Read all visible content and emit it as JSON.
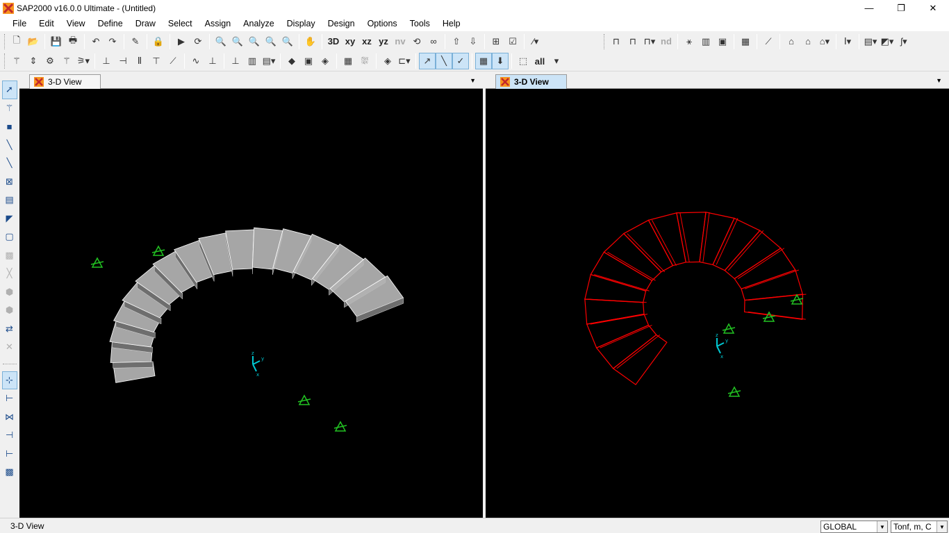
{
  "window": {
    "title": "SAP2000 v16.0.0 Ultimate  - (Untitled)",
    "minimize_glyph": "—",
    "restore_glyph": "❐",
    "close_glyph": "✕"
  },
  "menu": [
    "File",
    "Edit",
    "View",
    "Define",
    "Draw",
    "Select",
    "Assign",
    "Analyze",
    "Display",
    "Design",
    "Options",
    "Tools",
    "Help"
  ],
  "toolbar1": {
    "view_labels": {
      "three_d": "3D",
      "xy": "xy",
      "xz": "xz",
      "yz": "yz",
      "nv": "nv"
    },
    "nd_label": "nd"
  },
  "toolbar2": {
    "all_label": "all"
  },
  "panes": {
    "left": {
      "tab_label": "3-D View",
      "stair_color": "#bdbdbd",
      "support_color": "#22c322",
      "axes_color": "#00c8d2"
    },
    "right": {
      "tab_label": "3-D View",
      "stair_color": "#ff0000",
      "support_color": "#22c322",
      "axes_color": "#00c8d2"
    }
  },
  "axes_labels": {
    "x": "x",
    "y": "y",
    "z": "z"
  },
  "status": {
    "text": "3-D View",
    "coord_system": "GLOBAL",
    "units": "Tonf, m, C"
  }
}
